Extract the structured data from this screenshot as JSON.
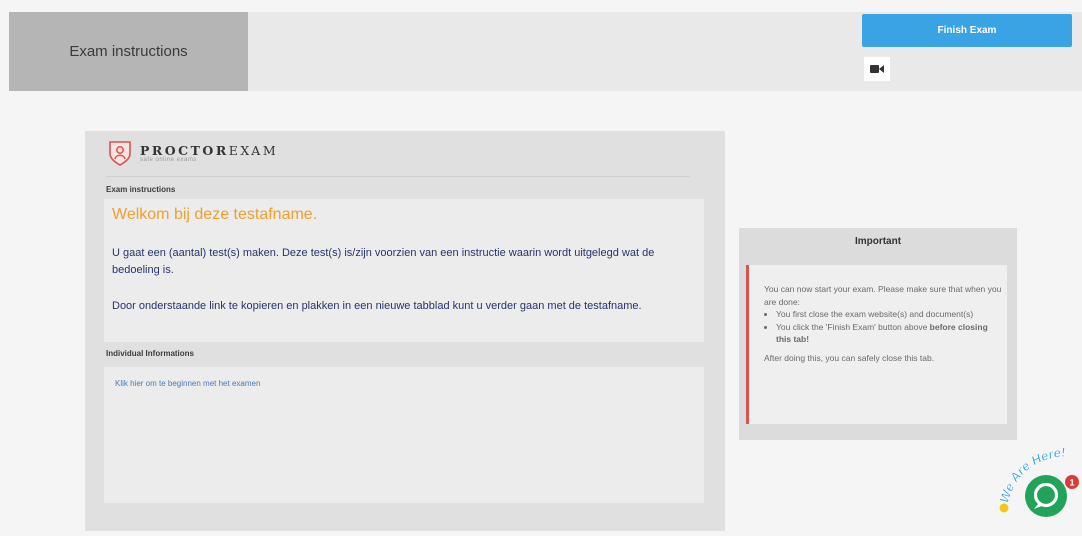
{
  "header": {
    "tab_label": "Exam instructions",
    "finish_label": "Finish Exam"
  },
  "logo": {
    "name_bold": "PROCTOR",
    "name_rest": "EXAM",
    "tagline": "safe online exams"
  },
  "instructions": {
    "section_label": "Exam instructions",
    "welcome": "Welkom bij deze testafname.",
    "para1": "U gaat een (aantal) test(s) maken. Deze test(s) is/zijn voorzien van een instructie waarin wordt uitgelegd wat de bedoeling is.",
    "para2": "Door onderstaande link te kopieren en plakken in een nieuwe tabblad kunt u verder gaan met de testafname."
  },
  "individual": {
    "section_label": "Individual Informations",
    "link_text": "Klik hier om te beginnen met het examen"
  },
  "important": {
    "title": "Important",
    "intro": "You can now start your exam. Please make sure that when you are done:",
    "bullet1": "You first close the exam website(s) and document(s)",
    "bullet2_prefix": "You click the 'Finish Exam' button above",
    "bullet2_bold": "before closing this tab!",
    "outro": "After doing this, you can safely close this tab."
  },
  "chat_widget": {
    "banner": "We Are Here!",
    "badge_count": "1"
  },
  "colors": {
    "accent_blue": "#3aa3e3",
    "welcome_orange": "#f0a02c",
    "alert_red": "#d9534f",
    "chat_green": "#22a35a"
  }
}
